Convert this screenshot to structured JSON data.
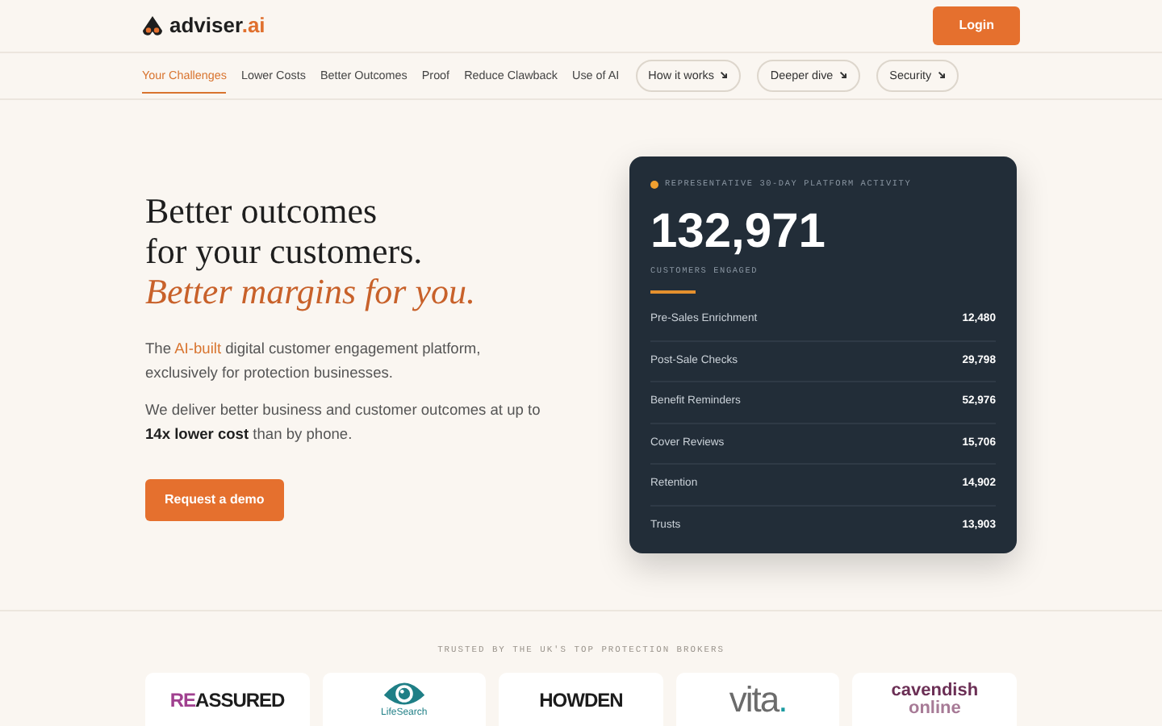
{
  "brand": {
    "name": "adviser",
    "suffix": ".ai"
  },
  "login": "Login",
  "nav": [
    {
      "label": "Your Challenges",
      "kind": "link",
      "selected": true
    },
    {
      "label": "Lower Costs",
      "kind": "link",
      "selected": false
    },
    {
      "label": "Better Outcomes",
      "kind": "link",
      "selected": false
    },
    {
      "label": "Proof",
      "kind": "link",
      "selected": false
    },
    {
      "label": "Reduce Clawback",
      "kind": "link",
      "selected": false
    },
    {
      "label": "Use of AI",
      "kind": "link",
      "selected": false
    },
    {
      "label": "How it works",
      "kind": "pill"
    },
    {
      "label": "Deeper dive",
      "kind": "pill"
    },
    {
      "label": "Security",
      "kind": "pill"
    }
  ],
  "hero": {
    "headline": [
      "Better outcomes",
      "for your customers."
    ],
    "accent": "Better margins for you.",
    "intro": {
      "before": "The ",
      "highlight": "AI-built",
      "after": " digital customer engagement platform, exclusively for protection businesses."
    },
    "body": "We deliver better business and customer outcomes at up to **14x lower cost** than by phone.",
    "cta": "Request a demo"
  },
  "stats_card": {
    "caption": "REPRESENTATIVE 30-DAY PLATFORM ACTIVITY",
    "dot": {
      "color": "#f0a030"
    },
    "total": "132,971",
    "total_label": "CUSTOMERS ENGAGED",
    "rows": [
      {
        "label": "Pre-Sales Enrichment",
        "value": "12,480"
      },
      {
        "label": "Post-Sale Checks",
        "value": "29,798"
      },
      {
        "label": "Benefit Reminders",
        "value": "52,976"
      },
      {
        "label": "Cover Reviews",
        "value": "15,706"
      },
      {
        "label": "Retention",
        "value": "14,902"
      },
      {
        "label": "Trusts",
        "value": "13,903"
      }
    ]
  },
  "trusted": {
    "heading": "TRUSTED BY THE UK'S TOP PROTECTION BROKERS",
    "logos": [
      {
        "kind": "wordmark",
        "parts": [
          {
            "text": "RE",
            "color": "#a0408f"
          },
          {
            "text": "ASSURED",
            "color": "#1c1c1c"
          }
        ]
      },
      {
        "kind": "eye",
        "parts": [
          {
            "text": "LifeSearch",
            "color": "#1f7f86"
          }
        ]
      },
      {
        "kind": "wordmark",
        "parts": [
          {
            "text": "HOWDEN",
            "color": "#1c1c1c"
          }
        ]
      },
      {
        "kind": "thin",
        "parts": [
          {
            "text": "vita",
            "color": "#6b6b6b"
          },
          {
            "text": ".",
            "color": "#1a9aa0"
          }
        ]
      },
      {
        "kind": "stacked",
        "parts": [
          {
            "text": "cavendish",
            "color": "#6b2f55"
          },
          {
            "text": "online",
            "color": "#a77a96"
          }
        ]
      }
    ]
  }
}
